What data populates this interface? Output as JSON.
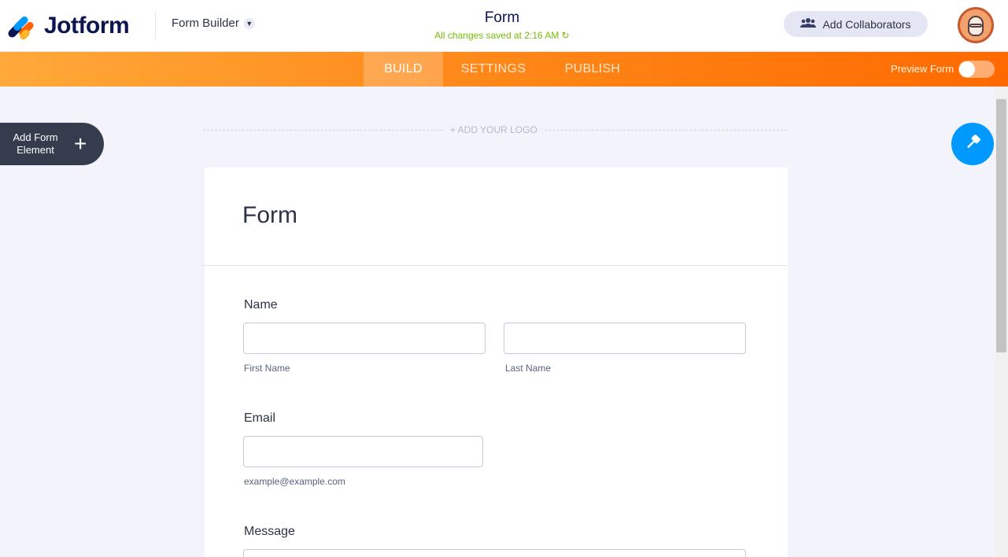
{
  "header": {
    "brand": "Jotform",
    "builder_label": "Form Builder",
    "form_title": "Form",
    "save_status": "All changes saved at 2:16 AM ↻",
    "collaborators_label": "Add Collaborators"
  },
  "nav": {
    "tabs": [
      {
        "label": "BUILD",
        "active": true
      },
      {
        "label": "SETTINGS",
        "active": false
      },
      {
        "label": "PUBLISH",
        "active": false
      }
    ],
    "preview_label": "Preview Form",
    "preview_on": false
  },
  "canvas": {
    "add_element_label": "Add Form Element",
    "add_logo_label": "+ ADD YOUR LOGO"
  },
  "form": {
    "title": "Form",
    "fields": {
      "name": {
        "label": "Name",
        "first_sublabel": "First Name",
        "last_sublabel": "Last Name"
      },
      "email": {
        "label": "Email",
        "sublabel": "example@example.com"
      },
      "message": {
        "label": "Message"
      }
    }
  },
  "colors": {
    "brand_navy": "#0a1551",
    "accent_orange": "#ff6100",
    "accent_blue": "#0099ff",
    "save_green": "#78bb07"
  }
}
